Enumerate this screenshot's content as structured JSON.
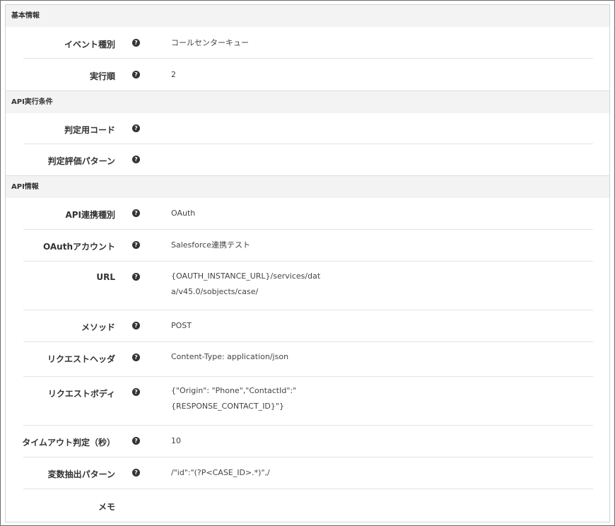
{
  "sections": [
    {
      "title": "基本情報"
    },
    {
      "title": "API実行条件"
    },
    {
      "title": "API情報"
    }
  ],
  "help_icon_glyph": "?",
  "rows": [
    {
      "label": "イベント種別",
      "value_lines": [
        "コールセンターキュー"
      ]
    },
    {
      "label": "実行順",
      "value_lines": [
        "2"
      ]
    },
    {
      "label": "判定用コード",
      "value_lines": []
    },
    {
      "label": "判定評価パターン",
      "value_lines": []
    },
    {
      "label": "API連携種別",
      "value_lines": [
        "OAuth"
      ]
    },
    {
      "label": "OAuthアカウント",
      "value_lines": [
        "Salesforce連携テスト"
      ]
    },
    {
      "label": "URL",
      "value_lines": [
        "{OAUTH_INSTANCE_URL}/services/dat",
        "a/v45.0/sobjects/case/"
      ]
    },
    {
      "label": "メソッド",
      "value_lines": [
        "POST"
      ]
    },
    {
      "label": "リクエストヘッダ",
      "value_lines": [
        "Content-Type: application/json"
      ]
    },
    {
      "label": "リクエストボディ",
      "value_lines": [
        "{\"Origin\": \"Phone\",\"ContactId\":\"",
        "{RESPONSE_CONTACT_ID}\"}"
      ]
    },
    {
      "label": "タイムアウト判定（秒）",
      "value_lines": [
        "10"
      ]
    },
    {
      "label": "変数抽出パターン",
      "value_lines": [
        "/\"id\":\"(?P<CASE_ID>.*)\",/"
      ]
    },
    {
      "label": "メモ",
      "value_lines": []
    }
  ]
}
